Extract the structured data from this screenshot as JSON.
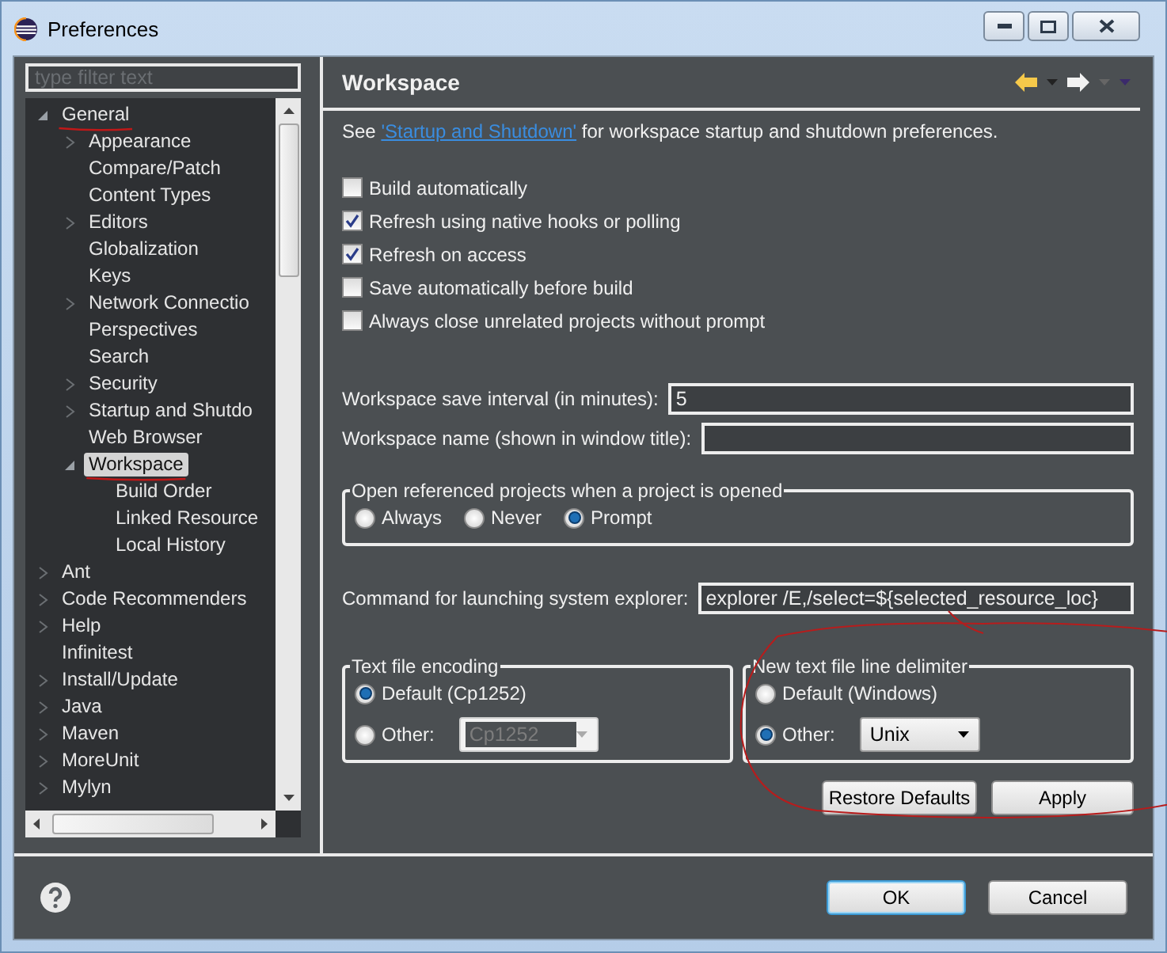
{
  "window": {
    "title": "Preferences"
  },
  "filter": {
    "placeholder": "type filter text"
  },
  "tree": [
    {
      "label": "General",
      "expanded": true,
      "selected": false,
      "children": [
        {
          "label": "Appearance",
          "expanded": false,
          "selected": false
        },
        {
          "label": "Compare/Patch",
          "selected": false
        },
        {
          "label": "Content Types",
          "selected": false
        },
        {
          "label": "Editors",
          "expanded": false,
          "selected": false
        },
        {
          "label": "Globalization",
          "selected": false
        },
        {
          "label": "Keys",
          "selected": false
        },
        {
          "label": "Network Connectio",
          "expanded": false,
          "selected": false
        },
        {
          "label": "Perspectives",
          "selected": false
        },
        {
          "label": "Search",
          "selected": false
        },
        {
          "label": "Security",
          "expanded": false,
          "selected": false
        },
        {
          "label": "Startup and Shutdo",
          "expanded": false,
          "selected": false
        },
        {
          "label": "Web Browser",
          "selected": false
        },
        {
          "label": "Workspace",
          "expanded": true,
          "selected": true,
          "children": [
            {
              "label": "Build Order",
              "selected": false
            },
            {
              "label": "Linked Resource",
              "selected": false
            },
            {
              "label": "Local History",
              "selected": false
            }
          ]
        }
      ]
    },
    {
      "label": "Ant",
      "expanded": false,
      "selected": false
    },
    {
      "label": "Code Recommenders",
      "expanded": false,
      "selected": false
    },
    {
      "label": "Help",
      "expanded": false,
      "selected": false
    },
    {
      "label": "Infinitest",
      "selected": false
    },
    {
      "label": "Install/Update",
      "expanded": false,
      "selected": false
    },
    {
      "label": "Java",
      "expanded": false,
      "selected": false
    },
    {
      "label": "Maven",
      "expanded": false,
      "selected": false
    },
    {
      "label": "MoreUnit",
      "expanded": false,
      "selected": false
    },
    {
      "label": "Mylyn",
      "expanded": false,
      "selected": false
    }
  ],
  "page": {
    "title": "Workspace",
    "intro": {
      "before": "See",
      "link": "'Startup and Shutdown'",
      "after": "for workspace startup and shutdown preferences."
    },
    "checkboxes": [
      {
        "label": "Build automatically",
        "checked": false
      },
      {
        "label": "Refresh using native hooks or polling",
        "checked": true
      },
      {
        "label": "Refresh on access",
        "checked": true
      },
      {
        "label": "Save automatically before build",
        "checked": false
      },
      {
        "label": "Always close unrelated projects without prompt",
        "checked": false
      }
    ],
    "fields": [
      {
        "label": "Workspace save interval (in minutes):",
        "value": "5"
      },
      {
        "label": "Workspace name (shown in window title):"
      }
    ],
    "open_referenced": {
      "title": "Open referenced projects when a project is opened",
      "options": [
        {
          "label": "Always",
          "selected": false
        },
        {
          "label": "Never",
          "selected": false
        },
        {
          "label": "Prompt",
          "selected": true
        }
      ]
    },
    "command": {
      "label": "Command for launching system explorer:",
      "value": "explorer /E,/select=${selected_resource_loc}"
    },
    "encoding": {
      "title": "Text file encoding",
      "options": [
        {
          "label": "Default (Cp1252)",
          "selected": true
        },
        {
          "label": "Other:",
          "selected": false,
          "combo": {
            "value": "Cp1252",
            "disabled": true
          }
        }
      ]
    },
    "delimiter": {
      "title": "New text file line delimiter",
      "options": [
        {
          "label": "Default (Windows)",
          "selected": false
        },
        {
          "label": "Other:",
          "selected": true,
          "combo": {
            "value": "Unix",
            "disabled": false
          }
        }
      ]
    },
    "buttons": [
      {
        "label": "Restore Defaults"
      },
      {
        "label": "Apply"
      }
    ]
  },
  "footer": {
    "buttons": [
      {
        "label": "OK",
        "default": true
      },
      {
        "label": "Cancel",
        "default": false
      }
    ]
  }
}
